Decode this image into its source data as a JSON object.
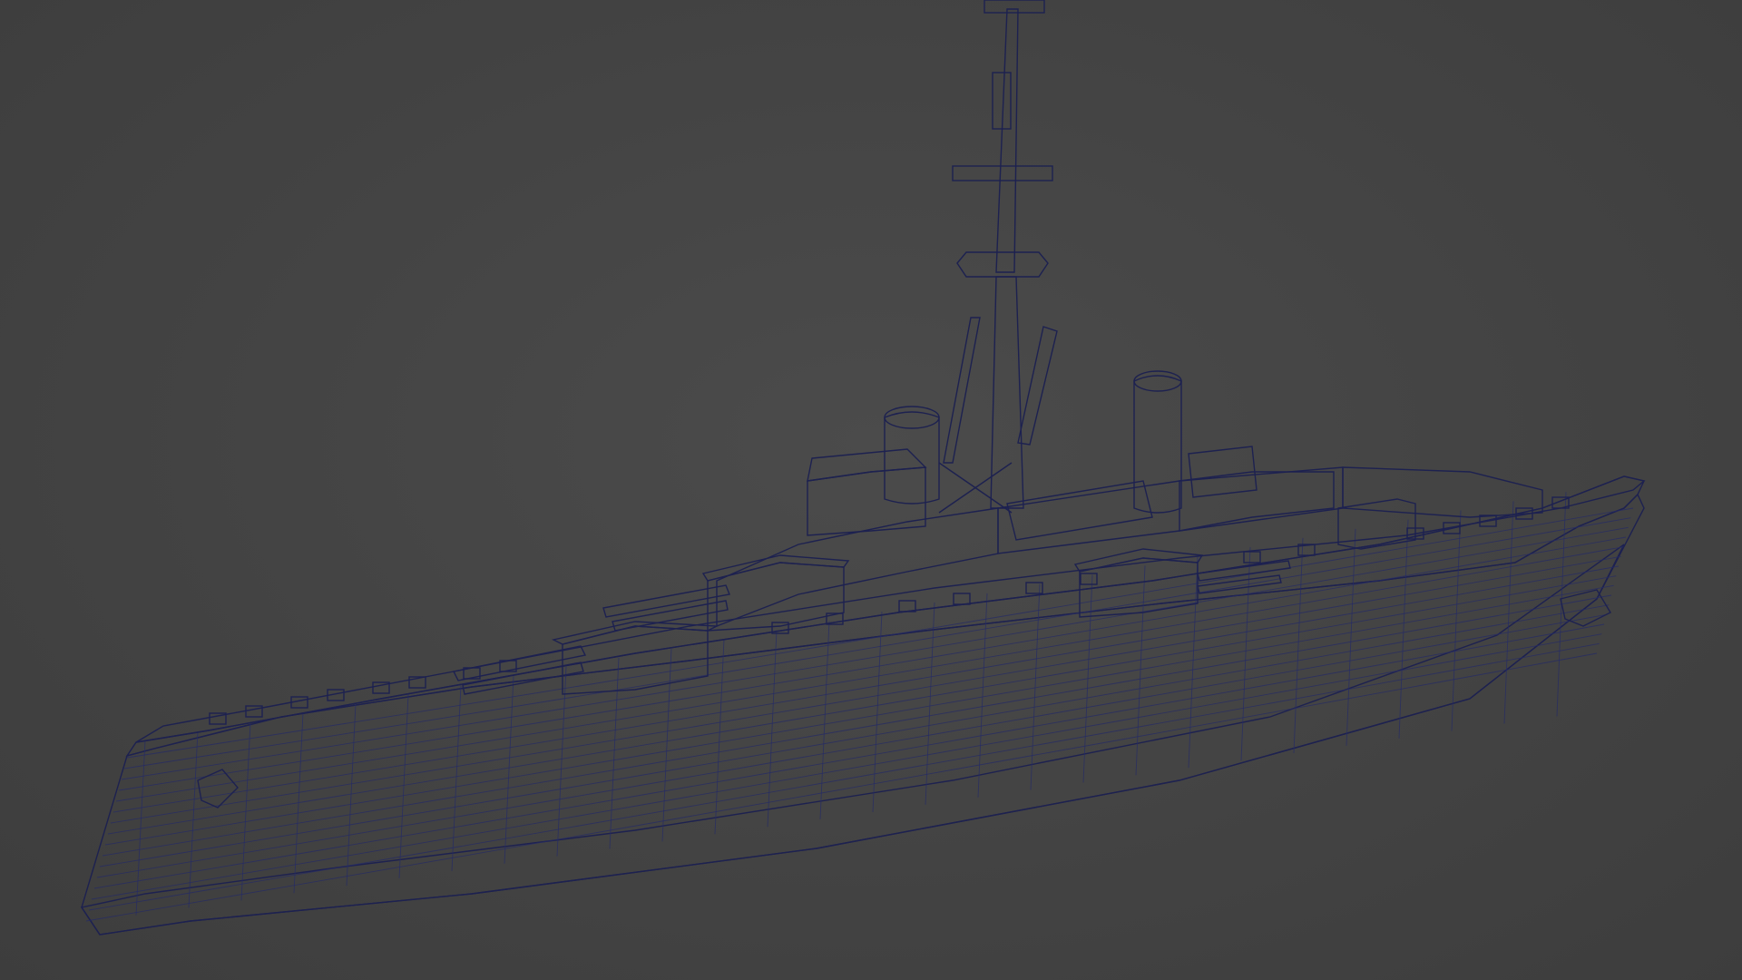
{
  "viewport": {
    "background_color": "#454545",
    "mesh_color": "#4f57b4",
    "wire_color": "#1d2150",
    "subject": "battleship-wireframe-model"
  }
}
